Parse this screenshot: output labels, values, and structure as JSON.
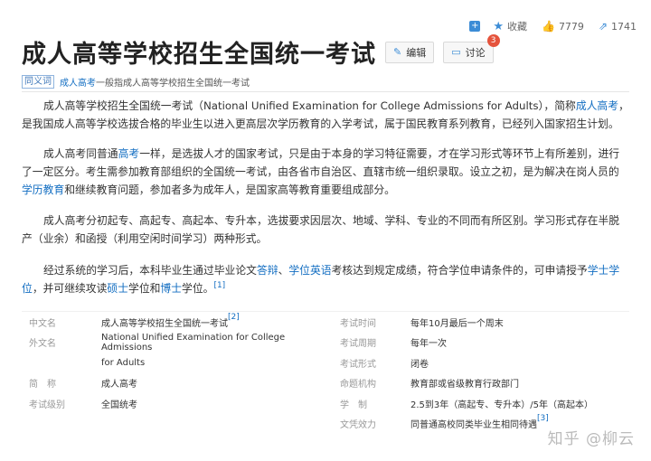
{
  "toolbar": {
    "favorite_label": "收藏",
    "like_count": "7779",
    "share_count": "1741"
  },
  "header": {
    "title": "成人高等学校招生全国统一考试",
    "edit_label": "编辑",
    "discuss_label": "讨论",
    "discuss_badge": "3"
  },
  "polysemy": {
    "tag": "同义词",
    "link": "成人高考",
    "text": "一般指成人高等学校招生全国统一考试"
  },
  "para1": {
    "t1": "成人高等学校招生全国统一考试（National Unified Examination for College Admissions for Adults），简称",
    "l1": "成人高考",
    "t2": "，是我国成人高等学校选拔合格的毕业生以进入更高层次学历教育的入学考试，属于国民教育系列教育，已经列入国家招生计划。"
  },
  "para2": {
    "t1": "成人高考同普通",
    "l1": "高考",
    "t2": "一样，是选拔人才的国家考试，只是由于本身的学习特征需要，才在学习形式等环节上有所差别，进行了一定区分。考生需参加教育部组织的全国统一考试，由各省市自治区、直辖市统一组织录取。设立之初，是为解决在岗人员的",
    "l2": "学历教育",
    "t3": "和继续教育问题，参加者多为成年人，是国家高等教育重要组成部分。"
  },
  "para3": {
    "t1": "成人高考分初起专、高起专、高起本、专升本，选拔要求因层次、地域、学科、专业的不同而有所区别。学习形式存在半脱产（业余）和函授（利用空闲时间学习）两种形式。"
  },
  "para4": {
    "t1": "经过系统的学习后，本科毕业生通过毕业论文",
    "l1": "答辩",
    "t2": "、",
    "l2": "学位英语",
    "t3": "考核达到规定成绩，符合学位申请条件的，可申请授予",
    "l3": "学士学位",
    "t4": "，并可继续攻读",
    "l4": "硕士",
    "t5": "学位和",
    "l5": "博士",
    "t6": "学位。",
    "ref": "[1]"
  },
  "info": {
    "rows": [
      {
        "label": "中文名",
        "value": "成人高等学校招生全国统一考试",
        "ref": "[2]",
        "label2": "考试时间",
        "value2": "每年10月最后一个周末",
        "ref2": ""
      },
      {
        "label": "外文名",
        "value": "National Unified Examination for College Admissions",
        "ref": "",
        "label2": "考试周期",
        "value2": "每年一次",
        "ref2": ""
      },
      {
        "label": "",
        "value": "for Adults",
        "ref": "",
        "label2": "考试形式",
        "value2": "闭卷",
        "ref2": ""
      },
      {
        "label": "简　称",
        "value": "成人高考",
        "ref": "",
        "label2": "命题机构",
        "value2": "教育部或省级教育行政部门",
        "ref2": ""
      },
      {
        "label": "考试级别",
        "value": "全国统考",
        "ref": "",
        "label2": "学　制",
        "value2": "2.5到3年（高起专、专升本）/5年（高起本）",
        "ref2": ""
      },
      {
        "label": "",
        "value": "",
        "ref": "",
        "label2": "文凭效力",
        "value2": "同普通高校同类毕业生相同待遇",
        "ref2": "[3]"
      }
    ]
  },
  "watermark": "知乎 @柳云"
}
